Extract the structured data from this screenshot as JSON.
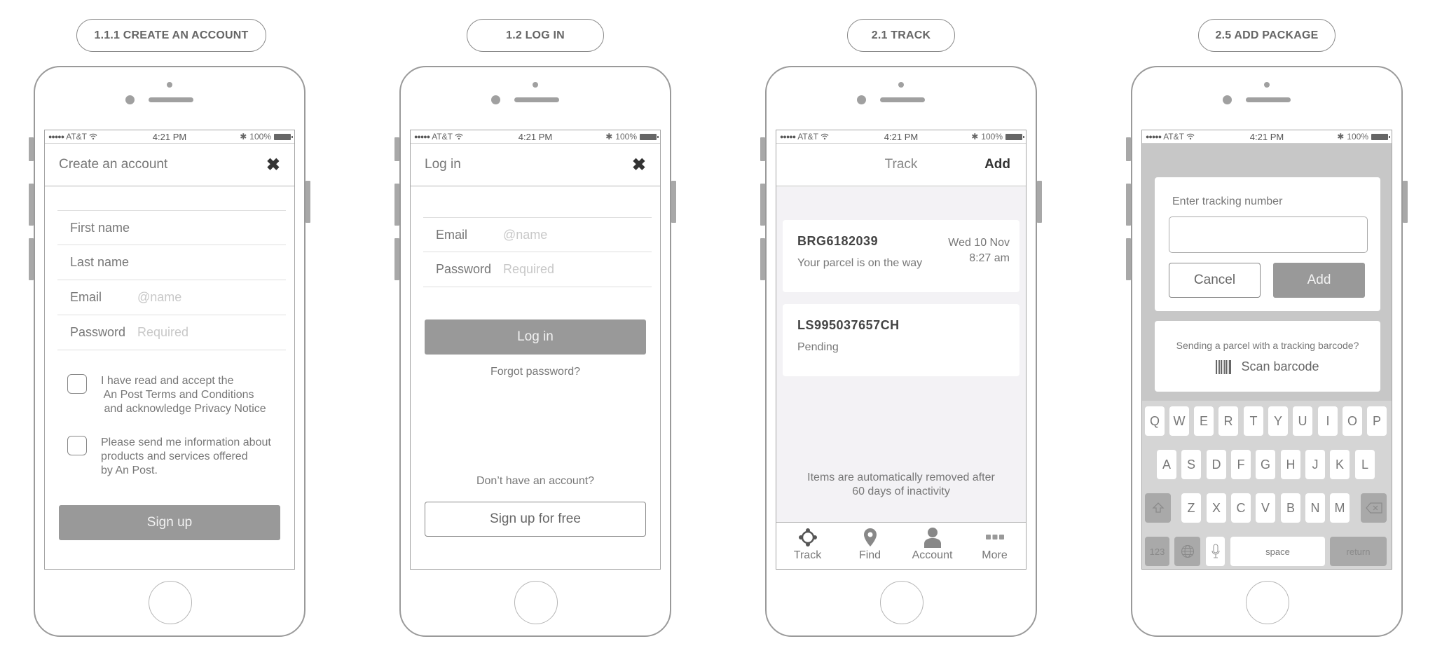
{
  "statusbar": {
    "carrier": "AT&T",
    "time": "4:21 PM",
    "battery": "100%",
    "signal_icon": "signal-dots-icon",
    "wifi_icon": "wifi-icon",
    "bluetooth_icon": "bluetooth-icon",
    "battery_icon": "battery-icon"
  },
  "screens": [
    {
      "label": "1.1.1 CREATE AN ACCOUNT",
      "title": "Create an account",
      "close_icon": "close-icon",
      "fields": [
        {
          "label": "First name",
          "placeholder": ""
        },
        {
          "label": "Last name",
          "placeholder": ""
        },
        {
          "label": "Email",
          "placeholder": "@name"
        },
        {
          "label": "Password",
          "placeholder": "Required"
        }
      ],
      "checkboxes": [
        {
          "text": "I have read and accept the\n An Post Terms and Conditions\n and acknowledge Privacy Notice",
          "checked": false
        },
        {
          "text": "Please send me information about\nproducts and services offered\nby An Post.",
          "checked": false
        }
      ],
      "submit": "Sign up"
    },
    {
      "label": "1.2 LOG IN",
      "title": "Log in",
      "close_icon": "close-icon",
      "fields": [
        {
          "label": "Email",
          "placeholder": "@name"
        },
        {
          "label": "Password",
          "placeholder": "Required"
        }
      ],
      "submit": "Log in",
      "forgot": "Forgot password?",
      "no_account": "Don’t have an account?",
      "signup": "Sign up for free"
    },
    {
      "label": "2.1 TRACK",
      "title": "Track",
      "add": "Add",
      "parcels": [
        {
          "id": "BRG6182039",
          "status": "Your parcel is on the way",
          "date": "Wed 10 Nov",
          "time": "8:27 am"
        },
        {
          "id": "LS995037657CH",
          "status": "Pending",
          "date": "",
          "time": ""
        }
      ],
      "note": "Items are automatically removed after\n60 days of inactivity",
      "tabs": [
        {
          "label": "Track",
          "icon": "crosshair-icon"
        },
        {
          "label": "Find",
          "icon": "map-pin-icon"
        },
        {
          "label": "Account",
          "icon": "user-icon"
        },
        {
          "label": "More",
          "icon": "more-dots-icon"
        }
      ]
    },
    {
      "label": "2.5 ADD PACKAGE",
      "input_label": "Enter tracking number",
      "input_value": "",
      "cancel": "Cancel",
      "add": "Add",
      "barcode_question": "Sending a parcel with a tracking barcode?",
      "scan": "Scan barcode",
      "scan_icon": "barcode-icon",
      "keyboard": {
        "row1": [
          "Q",
          "W",
          "E",
          "R",
          "T",
          "Y",
          "U",
          "I",
          "O",
          "P"
        ],
        "row2": [
          "A",
          "S",
          "D",
          "F",
          "G",
          "H",
          "J",
          "K",
          "L"
        ],
        "row3": [
          "Z",
          "X",
          "C",
          "V",
          "B",
          "N",
          "M"
        ],
        "numbers": "123",
        "space": "space",
        "return": "return",
        "shift_icon": "shift-icon",
        "delete_icon": "backspace-icon",
        "globe_icon": "globe-icon",
        "mic_icon": "microphone-icon"
      }
    }
  ]
}
